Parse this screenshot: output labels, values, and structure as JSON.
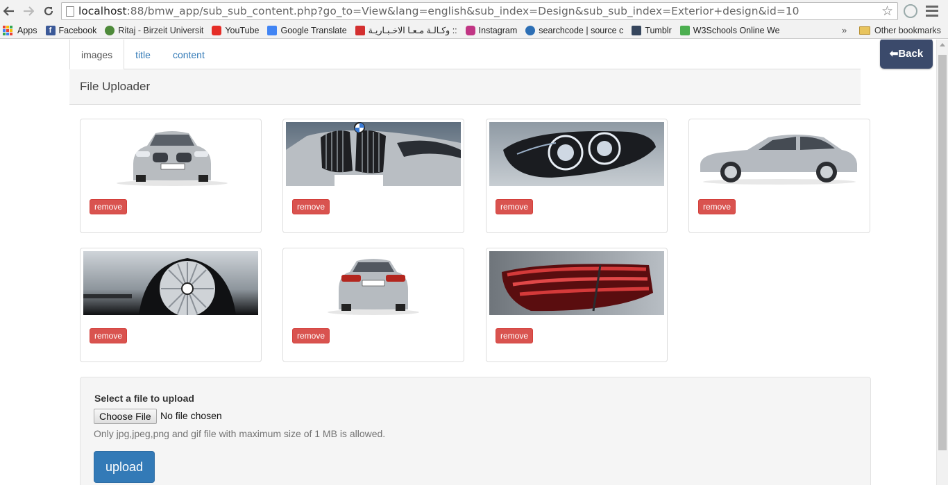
{
  "browser": {
    "url_host": "localhost",
    "url_rest": ":88/bmw_app/sub_sub_content.php?go_to=View&lang=english&sub_index=Design&sub_sub_index=Exterior+design&id=10",
    "bookmarks": [
      {
        "label": "Apps",
        "icon": "apps-grid-icon"
      },
      {
        "label": "Facebook",
        "icon": "facebook-icon"
      },
      {
        "label": "Ritaj - Birzeit Universit",
        "icon": "ritaj-icon"
      },
      {
        "label": "YouTube",
        "icon": "youtube-icon"
      },
      {
        "label": "Google Translate",
        "icon": "google-translate-icon"
      },
      {
        "label": "وكـالـة مـعـا الاخـبـاريـة ::",
        "icon": "maan-icon"
      },
      {
        "label": "Instagram",
        "icon": "instagram-icon"
      },
      {
        "label": "searchcode | source c",
        "icon": "searchcode-icon"
      },
      {
        "label": "Tumblr",
        "icon": "tumblr-icon"
      },
      {
        "label": "W3Schools Online We",
        "icon": "w3schools-icon"
      }
    ],
    "other_bookmarks": "Other bookmarks",
    "more_bookmarks": "»"
  },
  "tabs": [
    {
      "label": "images",
      "active": true
    },
    {
      "label": "title",
      "active": false
    },
    {
      "label": "content",
      "active": false
    }
  ],
  "back_button": "⬅Back",
  "panel_title": "File Uploader",
  "images": [
    {
      "alt": "BMW 5 series front view",
      "remove_label": "remove"
    },
    {
      "alt": "BMW kidney grille closeup",
      "remove_label": "remove"
    },
    {
      "alt": "BMW headlight closeup",
      "remove_label": "remove"
    },
    {
      "alt": "BMW 5 series side view",
      "remove_label": "remove"
    },
    {
      "alt": "BMW wheel closeup",
      "remove_label": "remove"
    },
    {
      "alt": "BMW 5 series rear view",
      "remove_label": "remove"
    },
    {
      "alt": "BMW tail light closeup",
      "remove_label": "remove"
    }
  ],
  "upload": {
    "label": "Select a file to upload",
    "choose_button": "Choose File",
    "no_file": "No file chosen",
    "help": "Only jpg,jpeg,png and gif file with maximum size of 1 MB is allowed.",
    "submit": "upload"
  },
  "colors": {
    "danger": "#d9534f",
    "primary": "#337ab7",
    "back": "#3b4a6b"
  }
}
